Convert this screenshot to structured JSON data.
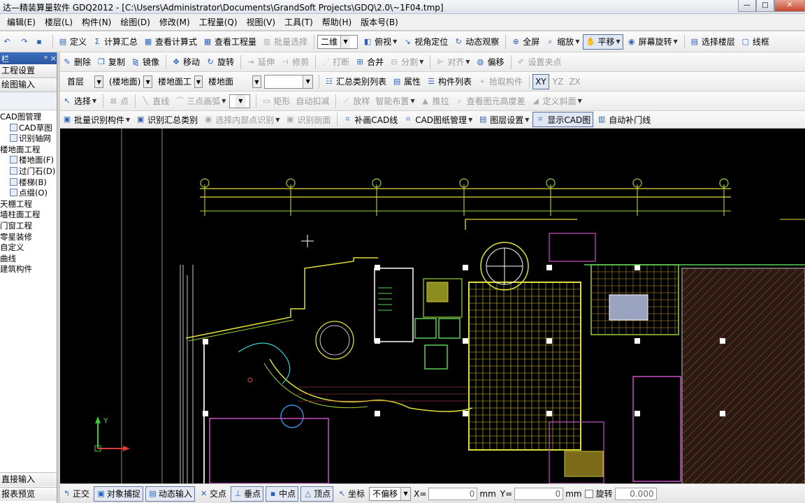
{
  "window": {
    "title": "达—精装算量软件 GDQ2012 - [C:\\Users\\Administrator\\Documents\\GrandSoft Projects\\GDQ\\2.0\\~1F04.tmp]",
    "min": "—",
    "max": "□"
  },
  "menu": [
    "编辑(E)",
    "楼层(L)",
    "构件(N)",
    "绘图(D)",
    "修改(M)",
    "工程量(Q)",
    "视图(V)",
    "工具(T)",
    "帮助(H)",
    "版本号(B)"
  ],
  "toolbar1": {
    "define": "定义",
    "calc_summary": "计算汇总",
    "view_formula": "查看计算式",
    "view_quantity": "查看工程量",
    "batch_select": "批量选择",
    "view_mode": "二维",
    "top_view": "俯视",
    "view_locate": "视角定位",
    "dynamic_view": "动态观察",
    "fullscreen": "全屏",
    "zoom": "缩放",
    "pan": "平移",
    "screen_rotate": "屏幕旋转",
    "select_floor": "选择楼层",
    "wireframe": "线框"
  },
  "toolbar2": {
    "delete": "删除",
    "copy": "复制",
    "mirror": "镜像",
    "move": "移动",
    "rotate": "旋转",
    "extend": "延伸",
    "trim": "修剪",
    "break": "打断",
    "merge": "合并",
    "split": "分割",
    "align": "对齐",
    "offset": "偏移",
    "set_grip": "设置夹点"
  },
  "toolbar3": {
    "floor": "首层",
    "category": "(楼地面)",
    "subcategory": "楼地面工",
    "component": "楼地面",
    "empty_combo": "",
    "summary_list": "汇总类别列表",
    "properties": "属性",
    "component_list": "构件列表",
    "pick_component": "拾取构件",
    "plane_xy": "XY",
    "plane_yz": "YZ",
    "plane_zx": "ZX"
  },
  "toolbar4": {
    "select": "选择",
    "point": "点",
    "line": "直线",
    "arc": "三点画弧",
    "rect": "矩形",
    "auto_deduct": "自动扣减",
    "slope": "放样",
    "smart_layout": "智能布置",
    "extrude": "推拉",
    "view_elevation_diff": "查看图元高度差",
    "define_slope": "定义斜面"
  },
  "toolbar5": {
    "batch_identify": "批量识别构件",
    "identify_summary": "识别汇总类别",
    "select_inner": "选择内部点识别",
    "identify_section": "识别剖面",
    "draw_cad_line": "补画CAD线",
    "cad_manage": "CAD图纸管理",
    "layer_settings": "图层设置",
    "show_cad": "显示CAD图",
    "auto_door_window": "自动补门线"
  },
  "left_panel": {
    "header": "栏",
    "pin": "ᵖ",
    "close": "×",
    "project_settings": "工程设置",
    "drawing_input": "绘图输入",
    "tree": [
      {
        "label": "CAD图管理",
        "level": 0
      },
      {
        "label": "CAD草图",
        "level": 1
      },
      {
        "label": "识别轴网",
        "level": 1
      },
      {
        "label": "楼地面工程",
        "level": 0
      },
      {
        "label": "楼地面(F)",
        "level": 1
      },
      {
        "label": "过门石(D)",
        "level": 1
      },
      {
        "label": "楼梯(B)",
        "level": 1
      },
      {
        "label": "点缀(O)",
        "level": 1
      },
      {
        "label": "天棚工程",
        "level": 0
      },
      {
        "label": "墙柱面工程",
        "level": 0
      },
      {
        "label": "门窗工程",
        "level": 0
      },
      {
        "label": "零星装修",
        "level": 0
      },
      {
        "label": "自定义",
        "level": 0
      },
      {
        "label": "曲线",
        "level": 0
      },
      {
        "label": "建筑构件",
        "level": 0
      }
    ],
    "direct_input": "直接输入",
    "report_preview": "报表预览"
  },
  "status": {
    "ortho": "正交",
    "snap": "对象捕捉",
    "dynamic_input": "动态输入",
    "intersection": "交点",
    "perpendicular": "垂点",
    "midpoint": "中点",
    "vertex": "顶点",
    "coordinate": "坐标",
    "offset_mode": "不偏移",
    "x_label": "X=",
    "x_value": "0",
    "unit_mm": "mm",
    "y_label": "Y=",
    "y_value": "0",
    "rotate": "旋转",
    "angle_value": "0.000"
  },
  "canvas": {
    "axis_y": "Y"
  }
}
